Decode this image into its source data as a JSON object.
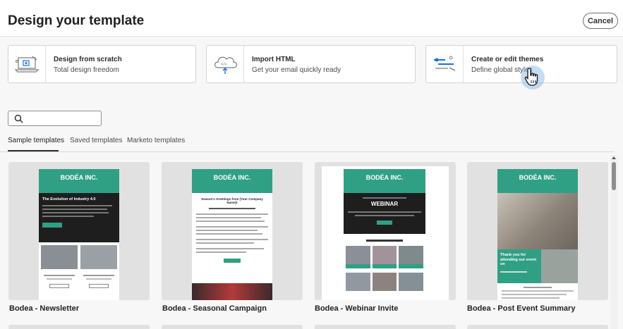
{
  "header": {
    "title": "Design your template",
    "cancel_label": "Cancel"
  },
  "cards": [
    {
      "title": "Design from scratch",
      "subtitle": "Total design freedom",
      "icon": "laptop-design-icon"
    },
    {
      "title": "Import HTML",
      "subtitle": "Get your email quickly ready",
      "icon": "cloud-upload-icon"
    },
    {
      "title": "Create or edit themes",
      "subtitle": "Define global styles",
      "icon": "themes-icon"
    }
  ],
  "search": {
    "placeholder": "",
    "value": "",
    "icon": "search-icon"
  },
  "tabs": [
    {
      "label": "Sample templates",
      "active": true
    },
    {
      "label": "Saved templates",
      "active": false
    },
    {
      "label": "Marketo templates",
      "active": false
    }
  ],
  "templates": [
    {
      "name": "Bodea - Newsletter",
      "brand": "BODÉA INC.",
      "headline": "The Evolution of Industry 4.0"
    },
    {
      "name": "Bodea - Seasonal Campaign",
      "brand": "BODÉA INC.",
      "headline": "Season's Greetings from [Your Company Name]!"
    },
    {
      "name": "Bodea - Webinar Invite",
      "brand": "BODÉA INC.",
      "headline": "WEBINAR"
    },
    {
      "name": "Bodea - Post Event Summary",
      "brand": "BODÉA INC.",
      "headline": "Thank you for attending our event on"
    }
  ],
  "colors": {
    "accent_teal": "#2fa083",
    "dark": "#1e1e1e"
  }
}
